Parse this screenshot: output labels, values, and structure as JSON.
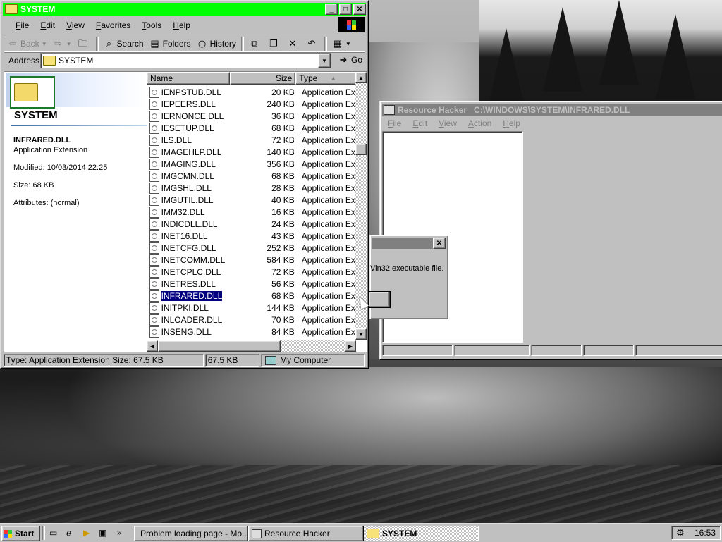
{
  "explorer": {
    "title": "SYSTEM",
    "menu": [
      "File",
      "Edit",
      "View",
      "Favorites",
      "Tools",
      "Help"
    ],
    "toolbar": {
      "back": "Back",
      "search": "Search",
      "folders": "Folders",
      "history": "History"
    },
    "address": {
      "label": "Address",
      "value": "SYSTEM",
      "go": "Go"
    },
    "webview": {
      "folder_title": "SYSTEM",
      "file_name": "INFRARED.DLL",
      "file_type": "Application Extension",
      "modified": "Modified: 10/03/2014 22:25",
      "size": "Size: 68 KB",
      "attributes": "Attributes: (normal)"
    },
    "columns": {
      "name": "Name",
      "size": "Size",
      "type": "Type"
    },
    "files": [
      {
        "name": "IENPSTUB.DLL",
        "size": "20 KB",
        "type": "Application Exte"
      },
      {
        "name": "IEPEERS.DLL",
        "size": "240 KB",
        "type": "Application Exte"
      },
      {
        "name": "IERNONCE.DLL",
        "size": "36 KB",
        "type": "Application Exte"
      },
      {
        "name": "IESETUP.DLL",
        "size": "68 KB",
        "type": "Application Exte"
      },
      {
        "name": "ILS.DLL",
        "size": "72 KB",
        "type": "Application Exte"
      },
      {
        "name": "IMAGEHLP.DLL",
        "size": "140 KB",
        "type": "Application Exte"
      },
      {
        "name": "IMAGING.DLL",
        "size": "356 KB",
        "type": "Application Exte"
      },
      {
        "name": "IMGCMN.DLL",
        "size": "68 KB",
        "type": "Application Exte"
      },
      {
        "name": "IMGSHL.DLL",
        "size": "28 KB",
        "type": "Application Exte"
      },
      {
        "name": "IMGUTIL.DLL",
        "size": "40 KB",
        "type": "Application Exte"
      },
      {
        "name": "IMM32.DLL",
        "size": "16 KB",
        "type": "Application Exte"
      },
      {
        "name": "INDICDLL.DLL",
        "size": "24 KB",
        "type": "Application Exte"
      },
      {
        "name": "INET16.DLL",
        "size": "43 KB",
        "type": "Application Exte"
      },
      {
        "name": "INETCFG.DLL",
        "size": "252 KB",
        "type": "Application Exte"
      },
      {
        "name": "INETCOMM.DLL",
        "size": "584 KB",
        "type": "Application Exte"
      },
      {
        "name": "INETCPLC.DLL",
        "size": "72 KB",
        "type": "Application Exte"
      },
      {
        "name": "INETRES.DLL",
        "size": "56 KB",
        "type": "Application Exte"
      },
      {
        "name": "INFRARED.DLL",
        "size": "68 KB",
        "type": "Application Exte",
        "selected": true
      },
      {
        "name": "INITPKI.DLL",
        "size": "144 KB",
        "type": "Application Exte"
      },
      {
        "name": "INLOADER.DLL",
        "size": "70 KB",
        "type": "Application Exte"
      },
      {
        "name": "INSENG.DLL",
        "size": "84 KB",
        "type": "Application Exte"
      }
    ],
    "status": {
      "info": "Type: Application Extension Size: 67.5 KB",
      "size": "67.5 KB",
      "zone": "My Computer"
    }
  },
  "reshack": {
    "title": "Resource Hacker   C:\\WINDOWS\\SYSTEM\\INFRARED.DLL",
    "menu": [
      "File",
      "Edit",
      "View",
      "Action",
      "Help"
    ]
  },
  "dialog": {
    "message": "Vin32 executable file."
  },
  "taskbar": {
    "start": "Start",
    "tasks": [
      {
        "label": "Problem loading page - Mo..."
      },
      {
        "label": "Resource Hacker"
      },
      {
        "label": "SYSTEM",
        "active": true
      }
    ],
    "time": "16:53"
  },
  "colors": {
    "active_title": "#00ff00",
    "selection": "#000080",
    "face": "#c0c0c0"
  }
}
